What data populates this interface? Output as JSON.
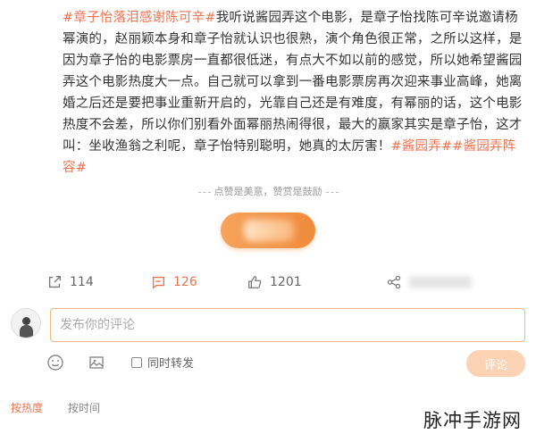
{
  "post": {
    "hashtag_lead": "#章子怡落泪感谢陈可辛#",
    "text": "我听说酱园弄这个电影，是章子怡找陈可辛说邀请杨幂演的，赵丽颖本身和章子怡就认识也很熟，演个角色很正常，之所以这样，是因为章子怡的电影票房一直都很低迷，有点大不如以前的感觉，所以她希望酱园弄这个电影热度大一点。自己就可以拿到一番电影票房再次迎来事业高峰，她离婚之后还是要把事业重新开启的，光靠自己还是有难度，有幂丽的话，这个电影热度不会差，所以你们别看外面幂丽热闹得很，最大的赢家其实是章子怡，这才叫：坐收渔翁之利呢，章子怡特别聪明，她真的太厉害！",
    "hashtag_tail": "#酱园弄##酱园弄阵容#"
  },
  "reward_note": "点赞是美意，赞赏是鼓励",
  "actions": {
    "share_count": "114",
    "comment_count": "126",
    "like_count": "1201"
  },
  "comment": {
    "placeholder": "发布你的评论",
    "also_repost_label": "同时转发",
    "submit_label": "评论"
  },
  "sort": {
    "by_hot": "按热度",
    "by_time": "按时间"
  },
  "watermark": "脉冲手游网",
  "colors": {
    "accent": "#eb7350",
    "input_border": "#f0b982",
    "submit_bg": "#fbd3b4",
    "reward_btn": "#f08a3c"
  }
}
